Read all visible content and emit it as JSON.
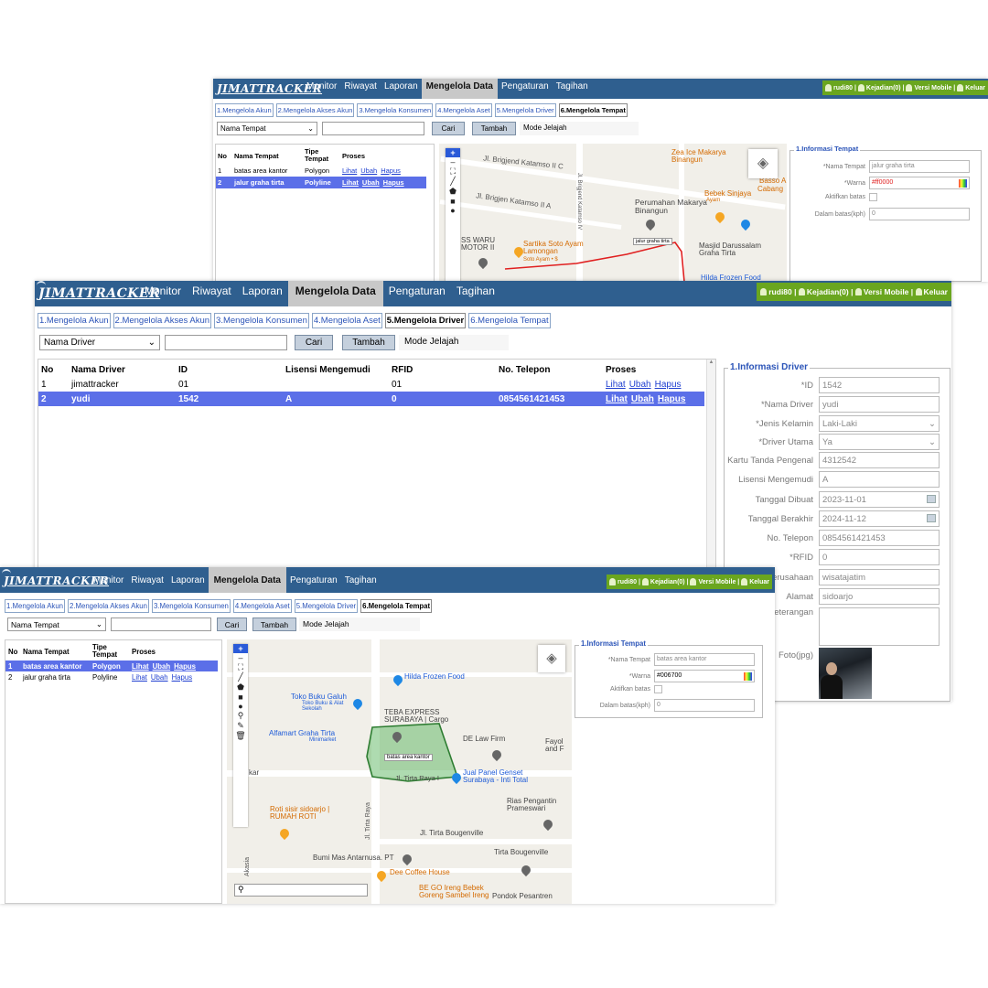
{
  "app": {
    "logo": "JIMATTRACKER",
    "menu": [
      "Monitor",
      "Riwayat",
      "Laporan",
      "Mengelola Data",
      "Pengaturan",
      "Tagihan"
    ],
    "user": "rudi80",
    "kejadian": "Kejadian(0)",
    "mobile": "Versi Mobile",
    "logout": "Keluar"
  },
  "tabs": [
    "1.Mengelola Akun",
    "2.Mengelola Akses Akun",
    "3.Mengelola Konsumen",
    "4.Mengelola Aset",
    "5.Mengelola Driver",
    "6.Mengelola Tempat"
  ],
  "toolbar": {
    "cari": "Cari",
    "tambah": "Tambah",
    "mode": "Mode Jelajah"
  },
  "tempat_screen_top": {
    "select": "Nama Tempat",
    "columns": [
      "No",
      "Nama Tempat",
      "Tipe Tempat",
      "Proses"
    ],
    "rows": [
      {
        "no": "1",
        "nama": "batas area kantor",
        "tipe": "Polygon"
      },
      {
        "no": "2",
        "nama": "jalur graha tirta",
        "tipe": "Polyline"
      }
    ],
    "actions": [
      "Lihat",
      "Ubah",
      "Hapus"
    ],
    "map": {
      "labels": [
        "Jl. Brigjend Katamso II C",
        "Jl. Brigjen Katamso II A",
        "Zea Ice Makarya Binangun",
        "Perumahan Makarya Binangun",
        "Bebek Sinjaya",
        "Ayam",
        "Basso A",
        "Cabang",
        "SS WARU MOTOR II",
        "Sartika Soto Ayam Lamongan",
        "Soto Ayam • $",
        "jalur graha tirta",
        "Masjid Darussalam Graha Tirta",
        "Hilda Frozen Food",
        "Jl. Brigjend Katamso IV"
      ]
    },
    "info": {
      "legend": "1.Informasi Tempat",
      "fields": [
        {
          "label": "*Nama Tempat",
          "value": "jalur graha tirta"
        },
        {
          "label": "*Warna",
          "value": "#ff0000"
        },
        {
          "label": "Aktifkan batas",
          "value": ""
        },
        {
          "label": "Dalam batas(kph)",
          "value": "0"
        }
      ]
    }
  },
  "driver_screen": {
    "select": "Nama Driver",
    "columns": [
      "No",
      "Nama Driver",
      "ID",
      "Lisensi Mengemudi",
      "RFID",
      "No. Telepon",
      "Proses"
    ],
    "rows": [
      {
        "no": "1",
        "nama": "jimattracker",
        "id": "01",
        "lisensi": "",
        "rfid": "01",
        "telp": ""
      },
      {
        "no": "2",
        "nama": "yudi",
        "id": "1542",
        "lisensi": "A",
        "rfid": "0",
        "telp": "0854561421453"
      }
    ],
    "actions": [
      "Lihat",
      "Ubah",
      "Hapus"
    ],
    "info": {
      "legend": "1.Informasi Driver",
      "fields": [
        {
          "label": "*ID",
          "value": "1542"
        },
        {
          "label": "*Nama Driver",
          "value": "yudi"
        },
        {
          "label": "*Jenis Kelamin",
          "value": "Laki-Laki"
        },
        {
          "label": "*Driver Utama",
          "value": "Ya"
        },
        {
          "label": "Kartu Tanda Pengenal",
          "value": "4312542"
        },
        {
          "label": "Lisensi Mengemudi",
          "value": "A"
        },
        {
          "label": "Tanggal Dibuat",
          "value": "2023-11-01"
        },
        {
          "label": "Tanggal Berakhir",
          "value": "2024-11-12"
        },
        {
          "label": "No. Telepon",
          "value": "0854561421453"
        },
        {
          "label": "*RFID",
          "value": "0"
        },
        {
          "label": "Perusahaan",
          "value": "wisatajatim"
        },
        {
          "label": "Alamat",
          "value": "sidoarjo"
        },
        {
          "label": "Keterangan",
          "value": ""
        },
        {
          "label": "Foto(jpg)",
          "value": ""
        }
      ]
    }
  },
  "tempat_screen_bottom": {
    "select": "Nama Tempat",
    "columns": [
      "No",
      "Nama Tempat",
      "Tipe Tempat",
      "Proses"
    ],
    "rows": [
      {
        "no": "1",
        "nama": "batas area kantor",
        "tipe": "Polygon"
      },
      {
        "no": "2",
        "nama": "jalur graha tirta",
        "tipe": "Polyline"
      }
    ],
    "actions": [
      "Lihat",
      "Ubah",
      "Hapus"
    ],
    "map": {
      "labels": [
        "Hilda Frozen Food",
        "Toko Buku Galuh",
        "Toko Buku & Alat Sekolah",
        "TEBA EXPRESS SURABAYA | Cargo",
        "Alfamart Graha Tirta",
        "Minimarket",
        "DE Law Firm",
        "Fayol and F",
        "batas area kantor",
        "Jl. Tirta Raya I",
        "Jual Panel Genset Surabaya - Inti Total",
        "Rias Pengantin Prameswari",
        "Roti sisir sidoarjo | RUMAH ROTI",
        "Jl. Tirta Raya",
        "Jl. Tirta Bougenville",
        "Tirta Bougenville",
        "Bumi Mas Antarnusa. PT",
        "Dee Coffee House",
        "BE GO Ireng Bebek Goreng Sambel Ireng",
        "Pondok Pesantren",
        "kar",
        "Akasia"
      ]
    },
    "info": {
      "legend": "1.Informasi Tempat",
      "fields": [
        {
          "label": "*Nama Tempat",
          "value": "batas area kantor"
        },
        {
          "label": "*Warna",
          "value": "#006700"
        },
        {
          "label": "Aktifkan batas",
          "value": ""
        },
        {
          "label": "Dalam batas(kph)",
          "value": "0"
        }
      ]
    }
  },
  "colors": {
    "navbar": "#2f5f8f",
    "selected_row": "#5b6fe8",
    "user_bar": "#6aa61f",
    "route": "#e02020",
    "polygon": "#2e7d32"
  }
}
